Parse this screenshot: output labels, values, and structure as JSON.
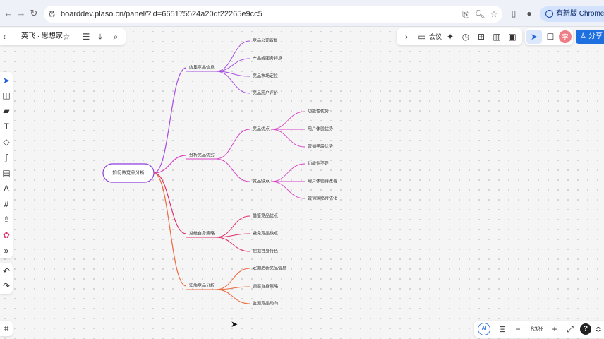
{
  "browser": {
    "url": "boarddev.plaso.cn/panel/?id=665175524a20df22265e9cc5",
    "update_label": "有新版 Chrome 可用"
  },
  "toolbar": {
    "title": "英飞 · 思想家",
    "meeting_label": "会议",
    "avatar_letter": "李",
    "share_label": "分享",
    "zoom_level": "83%"
  },
  "mindmap": {
    "root": "如何做竞品分析",
    "branches": [
      {
        "label": "收集竞品信息",
        "color": "#a64de0",
        "children": [
          {
            "label": "竞品公司背景"
          },
          {
            "label": "产品或服务特点"
          },
          {
            "label": "竞品市场定位"
          },
          {
            "label": "竞品用户评价"
          }
        ]
      },
      {
        "label": "分析竞品优劣",
        "color": "#d93fc4",
        "children": [
          {
            "label": "竞品优点",
            "children": [
              "功能性优势",
              "用户体验优势",
              "营销手段优势"
            ]
          },
          {
            "label": "竞品缺点",
            "children": [
              "功能性不足",
              "用户体验待改善",
              "营销策略待优化"
            ]
          }
        ]
      },
      {
        "label": "总结自身策略",
        "color": "#e0306a",
        "children": [
          {
            "label": "借鉴竞品优点"
          },
          {
            "label": "避免竞品缺点"
          },
          {
            "label": "挖掘自身特色"
          }
        ]
      },
      {
        "label": "实施竞品分析",
        "color": "#ec6a3c",
        "children": [
          {
            "label": "定期更新竞品信息"
          },
          {
            "label": "调整自身策略"
          },
          {
            "label": "监测竞品动向"
          }
        ]
      }
    ]
  }
}
